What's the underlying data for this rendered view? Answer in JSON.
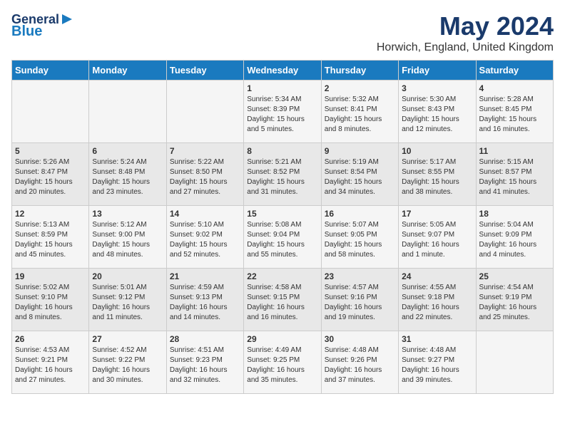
{
  "header": {
    "logo_line1": "General",
    "logo_line2": "Blue",
    "month": "May 2024",
    "location": "Horwich, England, United Kingdom"
  },
  "weekdays": [
    "Sunday",
    "Monday",
    "Tuesday",
    "Wednesday",
    "Thursday",
    "Friday",
    "Saturday"
  ],
  "weeks": [
    [
      {
        "day": "",
        "info": ""
      },
      {
        "day": "",
        "info": ""
      },
      {
        "day": "",
        "info": ""
      },
      {
        "day": "1",
        "info": "Sunrise: 5:34 AM\nSunset: 8:39 PM\nDaylight: 15 hours\nand 5 minutes."
      },
      {
        "day": "2",
        "info": "Sunrise: 5:32 AM\nSunset: 8:41 PM\nDaylight: 15 hours\nand 8 minutes."
      },
      {
        "day": "3",
        "info": "Sunrise: 5:30 AM\nSunset: 8:43 PM\nDaylight: 15 hours\nand 12 minutes."
      },
      {
        "day": "4",
        "info": "Sunrise: 5:28 AM\nSunset: 8:45 PM\nDaylight: 15 hours\nand 16 minutes."
      }
    ],
    [
      {
        "day": "5",
        "info": "Sunrise: 5:26 AM\nSunset: 8:47 PM\nDaylight: 15 hours\nand 20 minutes."
      },
      {
        "day": "6",
        "info": "Sunrise: 5:24 AM\nSunset: 8:48 PM\nDaylight: 15 hours\nand 23 minutes."
      },
      {
        "day": "7",
        "info": "Sunrise: 5:22 AM\nSunset: 8:50 PM\nDaylight: 15 hours\nand 27 minutes."
      },
      {
        "day": "8",
        "info": "Sunrise: 5:21 AM\nSunset: 8:52 PM\nDaylight: 15 hours\nand 31 minutes."
      },
      {
        "day": "9",
        "info": "Sunrise: 5:19 AM\nSunset: 8:54 PM\nDaylight: 15 hours\nand 34 minutes."
      },
      {
        "day": "10",
        "info": "Sunrise: 5:17 AM\nSunset: 8:55 PM\nDaylight: 15 hours\nand 38 minutes."
      },
      {
        "day": "11",
        "info": "Sunrise: 5:15 AM\nSunset: 8:57 PM\nDaylight: 15 hours\nand 41 minutes."
      }
    ],
    [
      {
        "day": "12",
        "info": "Sunrise: 5:13 AM\nSunset: 8:59 PM\nDaylight: 15 hours\nand 45 minutes."
      },
      {
        "day": "13",
        "info": "Sunrise: 5:12 AM\nSunset: 9:00 PM\nDaylight: 15 hours\nand 48 minutes."
      },
      {
        "day": "14",
        "info": "Sunrise: 5:10 AM\nSunset: 9:02 PM\nDaylight: 15 hours\nand 52 minutes."
      },
      {
        "day": "15",
        "info": "Sunrise: 5:08 AM\nSunset: 9:04 PM\nDaylight: 15 hours\nand 55 minutes."
      },
      {
        "day": "16",
        "info": "Sunrise: 5:07 AM\nSunset: 9:05 PM\nDaylight: 15 hours\nand 58 minutes."
      },
      {
        "day": "17",
        "info": "Sunrise: 5:05 AM\nSunset: 9:07 PM\nDaylight: 16 hours\nand 1 minute."
      },
      {
        "day": "18",
        "info": "Sunrise: 5:04 AM\nSunset: 9:09 PM\nDaylight: 16 hours\nand 4 minutes."
      }
    ],
    [
      {
        "day": "19",
        "info": "Sunrise: 5:02 AM\nSunset: 9:10 PM\nDaylight: 16 hours\nand 8 minutes."
      },
      {
        "day": "20",
        "info": "Sunrise: 5:01 AM\nSunset: 9:12 PM\nDaylight: 16 hours\nand 11 minutes."
      },
      {
        "day": "21",
        "info": "Sunrise: 4:59 AM\nSunset: 9:13 PM\nDaylight: 16 hours\nand 14 minutes."
      },
      {
        "day": "22",
        "info": "Sunrise: 4:58 AM\nSunset: 9:15 PM\nDaylight: 16 hours\nand 16 minutes."
      },
      {
        "day": "23",
        "info": "Sunrise: 4:57 AM\nSunset: 9:16 PM\nDaylight: 16 hours\nand 19 minutes."
      },
      {
        "day": "24",
        "info": "Sunrise: 4:55 AM\nSunset: 9:18 PM\nDaylight: 16 hours\nand 22 minutes."
      },
      {
        "day": "25",
        "info": "Sunrise: 4:54 AM\nSunset: 9:19 PM\nDaylight: 16 hours\nand 25 minutes."
      }
    ],
    [
      {
        "day": "26",
        "info": "Sunrise: 4:53 AM\nSunset: 9:21 PM\nDaylight: 16 hours\nand 27 minutes."
      },
      {
        "day": "27",
        "info": "Sunrise: 4:52 AM\nSunset: 9:22 PM\nDaylight: 16 hours\nand 30 minutes."
      },
      {
        "day": "28",
        "info": "Sunrise: 4:51 AM\nSunset: 9:23 PM\nDaylight: 16 hours\nand 32 minutes."
      },
      {
        "day": "29",
        "info": "Sunrise: 4:49 AM\nSunset: 9:25 PM\nDaylight: 16 hours\nand 35 minutes."
      },
      {
        "day": "30",
        "info": "Sunrise: 4:48 AM\nSunset: 9:26 PM\nDaylight: 16 hours\nand 37 minutes."
      },
      {
        "day": "31",
        "info": "Sunrise: 4:48 AM\nSunset: 9:27 PM\nDaylight: 16 hours\nand 39 minutes."
      },
      {
        "day": "",
        "info": ""
      }
    ]
  ]
}
